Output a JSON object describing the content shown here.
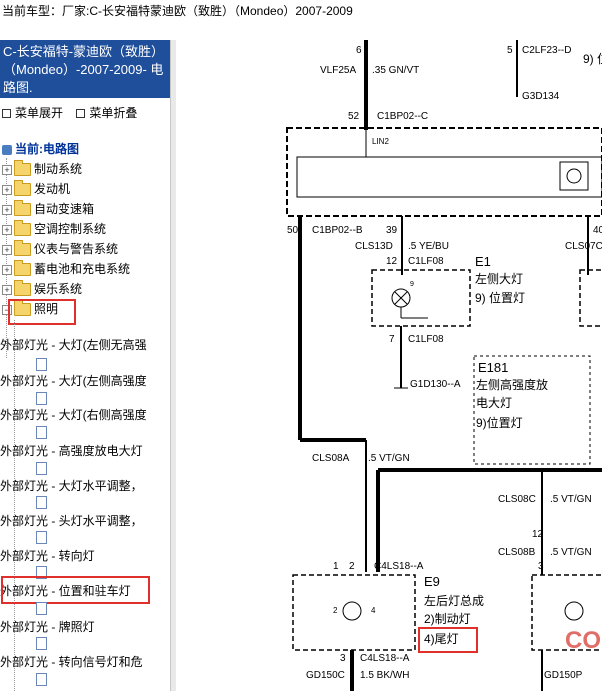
{
  "topbar": {
    "label": "当前车型：",
    "model": "厂家:C-长安福特蒙迪欧（致胜）（Mondeo）2007-2009"
  },
  "sidebar": {
    "title": "C-长安福特-蒙迪欧（致胜）（Mondeo）-2007-2009- 电路图.",
    "expand_all": "菜单展开",
    "collapse_all": "菜单折叠",
    "current": "当前:电路图",
    "categories": [
      "制动系统",
      "发动机",
      "自动变速箱",
      "空调控制系统",
      "仪表与警告系统",
      "蓄电池和充电系统",
      "娱乐系统",
      "照明"
    ],
    "leaves": [
      "外部灯光 - 大灯(左侧无高强",
      "外部灯光 - 大灯(左侧高强度",
      "外部灯光 - 大灯(右侧高强度",
      "外部灯光 - 高强度放电大灯",
      "外部灯光 - 大灯水平调整，",
      "外部灯光 - 头灯水平调整，",
      "外部灯光 - 转向灯",
      "外部灯光 - 位置和驻车灯",
      "外部灯光 - 牌照灯",
      "外部灯光 - 转向信号灯和危"
    ]
  },
  "diagram": {
    "pin6": "6",
    "vlf25a": "VLF25A",
    "wire1": ".35 GN/VT",
    "pin5": "5",
    "c2lf23d": "C2LF23--D",
    "nine_pos": "9) 位",
    "g3d134": "G3D134",
    "pin52": "52",
    "c1bp02c": "C1BP02--C",
    "lin2": "LIN2",
    "pin50": "50",
    "c1bp02b": "C1BP02--B",
    "pin39": "39",
    "pin40": "40",
    "cls13d": "CLS13D",
    "wire2": ".5 YE/BU",
    "cls07": "CLS07C",
    "pin12a": "12",
    "c1lf08a": "C1LF08",
    "e1": "E1",
    "e1_desc1": "左侧大灯",
    "e1_desc2": "9)  位置灯",
    "pin9": "9",
    "pin7": "7",
    "c1lf08b": "C1LF08",
    "e181": "E181",
    "e181_desc1": "左侧高强度放",
    "e181_desc2": "电大灯",
    "e181_desc3": "9)位置灯",
    "g1d130a": "G1D130--A",
    "cls08a": "CLS08A",
    "wire3": ".5 VT/GN",
    "cls08c": "CLS08C",
    "wire4": ".5 VT/GN",
    "pin12b": "12",
    "cls08b": "CLS08B",
    "wire5": ".5 VT/GN",
    "pin1": "1",
    "pin2": "2",
    "c4ls18a": "C4LS18--A",
    "pin3": "3",
    "e9": "E9",
    "e9_desc1": "左后灯总成",
    "e9_desc2": "2)制动灯",
    "e9_desc3": "4)尾灯",
    "p2": "2",
    "p4": "4",
    "pin3b": "3",
    "c4ls18a2": "C4LS18--A",
    "gd150c": "GD150C",
    "wire6": "1.5 BK/WH",
    "gd150p": "GD150P",
    "watermark": "CO"
  }
}
